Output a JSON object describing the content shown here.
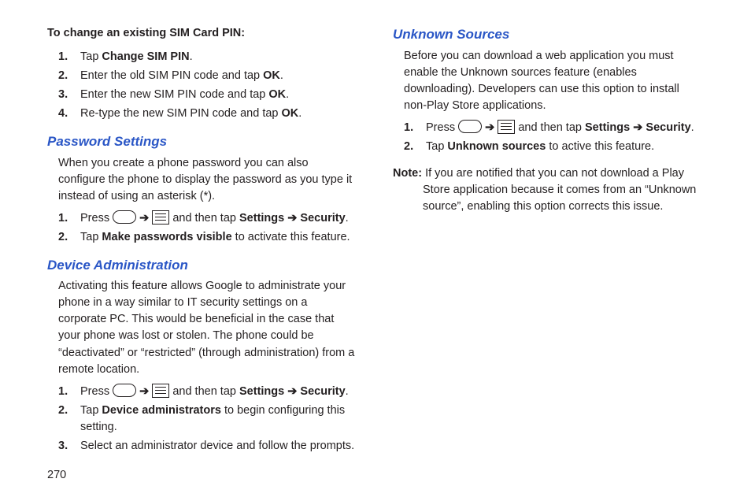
{
  "col1": {
    "leadHeading": "To change an existing SIM Card PIN:",
    "sim": {
      "s1_a": "Tap ",
      "s1_b": "Change SIM PIN",
      "s1_c": ".",
      "s2_a": "Enter the old SIM PIN code and tap ",
      "s2_b": "OK",
      "s2_c": ".",
      "s3_a": "Enter the new SIM PIN code and tap ",
      "s3_b": "OK",
      "s3_c": ".",
      "s4_a": "Re-type the new SIM PIN code and tap ",
      "s4_b": "OK",
      "s4_c": "."
    },
    "pwdHeading": "Password Settings",
    "pwdPara": "When you create a phone password you can also configure the phone to display the password as you type it instead of using an asterisk (*).",
    "pwd": {
      "s1_a": "Press ",
      "s1_b": " and then tap ",
      "s1_c": "Settings ",
      "s1_d": " Security",
      "s1_e": ".",
      "s2_a": "Tap ",
      "s2_b": "Make passwords visible",
      "s2_c": " to activate this feature."
    },
    "devHeading": "Device Administration",
    "devPara": "Activating this feature allows Google to administrate your phone in a way similar to IT security settings on a corporate PC. This would be beneficial in the case that your phone was lost or stolen. The phone could be “deactivated” or “restricted” (through administration) from a remote location.",
    "dev": {
      "s1_a": "Press ",
      "s1_b": " and then tap ",
      "s1_c": "Settings ",
      "s1_d": " Security",
      "s1_e": ".",
      "s2_a": "Tap ",
      "s2_b": "Device administrators",
      "s2_c": " to begin configuring this setting.",
      "s3": "Select an administrator device and follow the prompts."
    },
    "pageNum": "270"
  },
  "col2": {
    "unkHeading": "Unknown Sources",
    "unkPara": "Before you can download a web application you must enable the Unknown sources feature (enables downloading). Developers can use this option to install non-Play Store applications.",
    "unk": {
      "s1_a": "Press ",
      "s1_b": " and then tap ",
      "s1_c": "Settings ",
      "s1_d": " Security",
      "s1_e": ".",
      "s2_a": "Tap ",
      "s2_b": "Unknown sources",
      "s2_c": " to active this feature."
    },
    "noteLabel": "Note:",
    "noteText": " If you are notified that you can not download a Play Store application because it comes from an “Unknown source”, enabling this option corrects this issue."
  },
  "arrow": "➔"
}
